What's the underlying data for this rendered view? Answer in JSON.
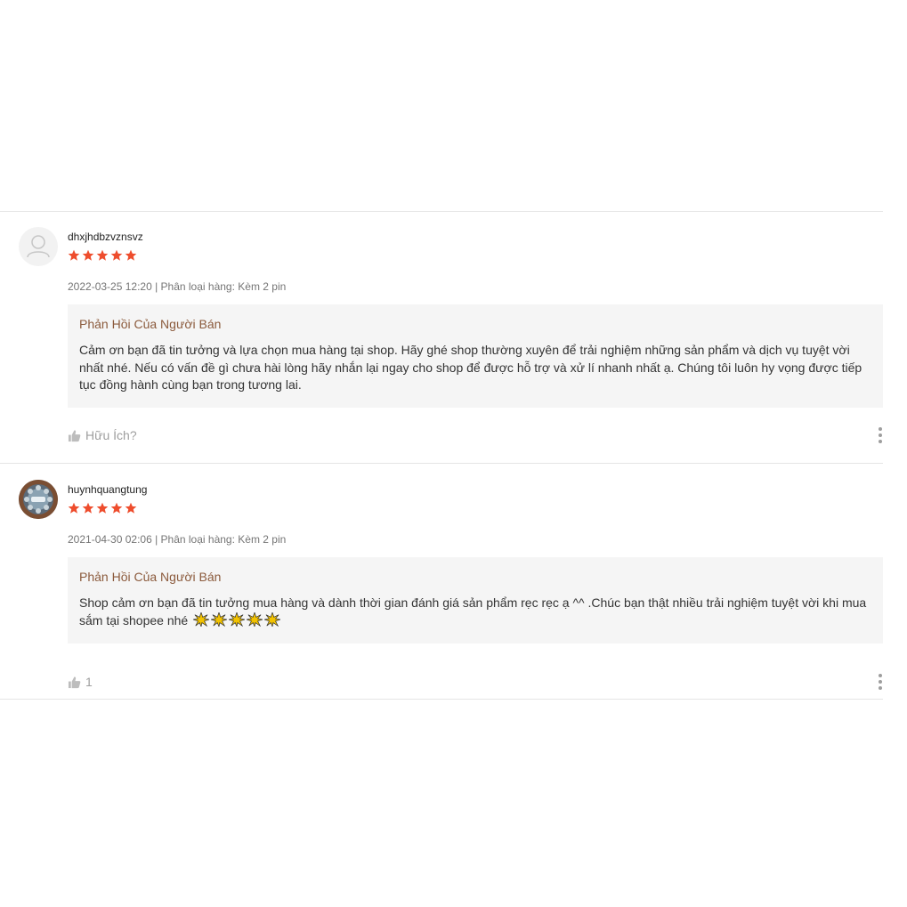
{
  "colors": {
    "star": "#ee4d2d",
    "reply_title": "#8b5a3c",
    "muted": "#9e9e9e"
  },
  "reviews": [
    {
      "username": "dhxjhdbzvznsvz",
      "rating": 5,
      "avatar_icon": "default-user-icon",
      "meta": "2022-03-25 12:20 | Phân loại hàng: Kèm 2 pin",
      "reply_title": "Phản Hồi Của Người Bán",
      "reply_text": "Cảm ơn bạn đã tin tưởng và lựa chọn mua hàng tại shop. Hãy ghé shop thường xuyên để trải nghiệm những sản phẩm và dịch vụ tuyệt vời nhất nhé. Nếu có vấn đề gì chưa hài lòng hãy nhắn lại ngay cho shop để được hỗ trợ và xử lí nhanh nhất ạ. Chúng tôi luôn hy vọng được tiếp tục đồng hành cùng bạn trong tương lai.",
      "like_label": "Hữu Ích?"
    },
    {
      "username": "huynhquangtung",
      "rating": 5,
      "avatar_icon": "user-photo-avatar",
      "meta": "2021-04-30 02:06 | Phân loại hàng: Kèm 2 pin",
      "reply_title": "Phản Hồi Của Người Bán",
      "reply_text": "Shop cảm ơn bạn đã tin tưởng mua hàng và dành thời gian đánh giá sản phẩm rẹc rẹc ạ ^^ .Chúc bạn thật nhiều trải nghiệm tuyệt vời khi mua sắm tại shopee nhé",
      "reply_emoji": "sparkle-emoji x5",
      "like_label": "1"
    }
  ]
}
